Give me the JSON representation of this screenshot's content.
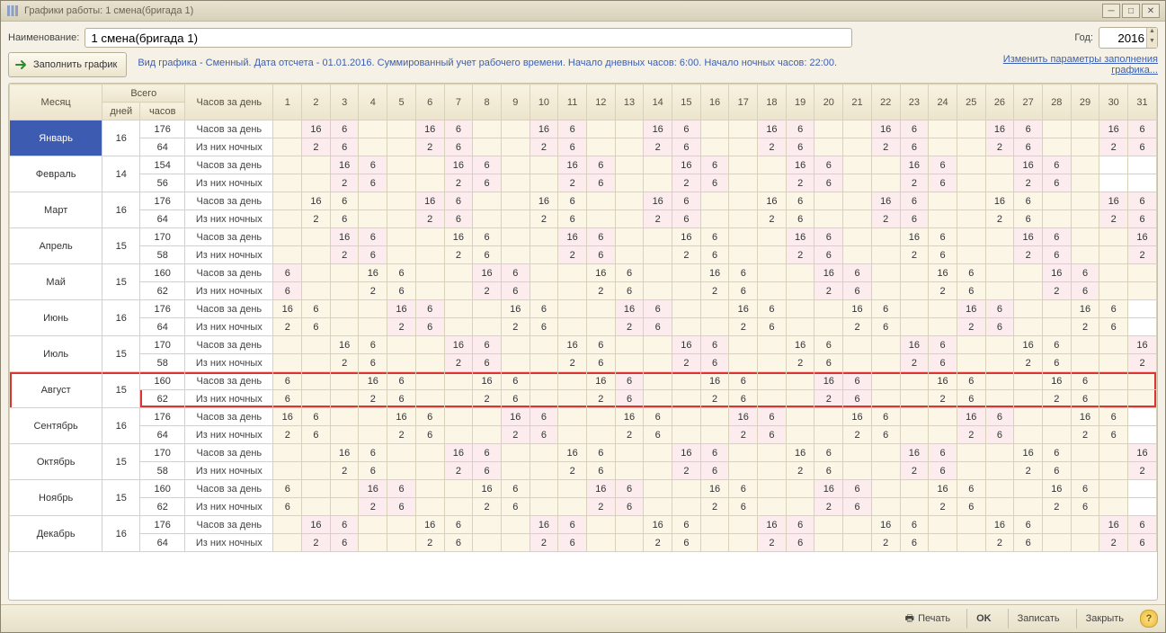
{
  "window": {
    "title": "Графики работы: 1 смена(бригада 1)"
  },
  "toolbar": {
    "name_label": "Наименование:",
    "name_value": "1 смена(бригада 1)",
    "year_label": "Год:",
    "year_value": "2016",
    "fill_label": "Заполнить график",
    "info_text": "Вид графика - Сменный. Дата отсчета - 01.01.2016. Суммированный учет рабочего времени. Начало дневных часов: 6:00. Начало ночных часов: 22:00.",
    "change_link": "Изменить параметры заполнения графика..."
  },
  "footer": {
    "print": "Печать",
    "ok": "OK",
    "save": "Записать",
    "close": "Закрыть"
  },
  "headers": {
    "month": "Месяц",
    "total": "Всего",
    "days": "дней",
    "hours": "часов",
    "row_label": "Часов за день"
  },
  "row_labels": {
    "day": "Часов за день",
    "night": "Из них ночных"
  },
  "day_numbers": [
    1,
    2,
    3,
    4,
    5,
    6,
    7,
    8,
    9,
    10,
    11,
    12,
    13,
    14,
    15,
    16,
    17,
    18,
    19,
    20,
    21,
    22,
    23,
    24,
    25,
    26,
    27,
    28,
    29,
    30,
    31
  ],
  "highlight_month": "Август",
  "selected_month": "Январь",
  "months": [
    {
      "name": "Январь",
      "days": 16,
      "hours": 176,
      "night_hours": 64,
      "pattern": [
        null,
        [
          16,
          2
        ],
        [
          6,
          6
        ],
        null,
        null,
        [
          16,
          2
        ],
        [
          6,
          6
        ],
        null,
        null,
        [
          16,
          2
        ],
        [
          6,
          6
        ],
        null,
        null,
        [
          16,
          2
        ],
        [
          6,
          6
        ],
        null,
        null,
        [
          16,
          2
        ],
        [
          6,
          6
        ],
        null,
        null,
        [
          16,
          2
        ],
        [
          6,
          6
        ],
        null,
        null,
        [
          16,
          2
        ],
        [
          6,
          6
        ],
        null,
        null,
        [
          16,
          2
        ],
        [
          6,
          6
        ]
      ],
      "pink": [
        2,
        3,
        6,
        7,
        10,
        11,
        14,
        15,
        18,
        19,
        22,
        23,
        26,
        27,
        30,
        31
      ],
      "cream": [
        1,
        4,
        5,
        8,
        9,
        12,
        13,
        16,
        17,
        20,
        21,
        24,
        25,
        28,
        29
      ]
    },
    {
      "name": "Февраль",
      "days": 14,
      "hours": 154,
      "night_hours": 56,
      "pattern": [
        null,
        null,
        [
          16,
          2
        ],
        [
          6,
          6
        ],
        null,
        null,
        [
          16,
          2
        ],
        [
          6,
          6
        ],
        null,
        null,
        [
          16,
          2
        ],
        [
          6,
          6
        ],
        null,
        null,
        [
          16,
          2
        ],
        [
          6,
          6
        ],
        null,
        null,
        [
          16,
          2
        ],
        [
          6,
          6
        ],
        null,
        null,
        [
          16,
          2
        ],
        [
          6,
          6
        ],
        null,
        null,
        [
          16,
          2
        ],
        [
          6,
          6
        ],
        null,
        null,
        null
      ],
      "pink": [
        3,
        4,
        7,
        8,
        11,
        12,
        15,
        16,
        19,
        20,
        23,
        24,
        27,
        28
      ],
      "cream": [
        1,
        2,
        5,
        6,
        9,
        10,
        13,
        14,
        17,
        18,
        21,
        22,
        25,
        26,
        29
      ]
    },
    {
      "name": "Март",
      "days": 16,
      "hours": 176,
      "night_hours": 64,
      "pattern": [
        null,
        [
          16,
          2
        ],
        [
          6,
          6
        ],
        null,
        null,
        [
          16,
          2
        ],
        [
          6,
          6
        ],
        null,
        null,
        [
          16,
          2
        ],
        [
          6,
          6
        ],
        null,
        null,
        [
          16,
          2
        ],
        [
          6,
          6
        ],
        null,
        null,
        [
          16,
          2
        ],
        [
          6,
          6
        ],
        null,
        null,
        [
          16,
          2
        ],
        [
          6,
          6
        ],
        null,
        null,
        [
          16,
          2
        ],
        [
          6,
          6
        ],
        null,
        null,
        [
          16,
          2
        ],
        [
          6,
          6
        ]
      ],
      "pink": [
        6,
        7,
        14,
        15,
        22,
        23,
        30,
        31
      ],
      "cream": [
        1,
        2,
        3,
        4,
        5,
        8,
        9,
        10,
        11,
        12,
        13,
        16,
        17,
        18,
        19,
        20,
        21,
        24,
        25,
        26,
        27,
        28,
        29
      ]
    },
    {
      "name": "Апрель",
      "days": 15,
      "hours": 170,
      "night_hours": 58,
      "pattern": [
        null,
        null,
        [
          16,
          2
        ],
        [
          6,
          6
        ],
        null,
        null,
        [
          16,
          2
        ],
        [
          6,
          6
        ],
        null,
        null,
        [
          16,
          2
        ],
        [
          6,
          6
        ],
        null,
        null,
        [
          16,
          2
        ],
        [
          6,
          6
        ],
        null,
        null,
        [
          16,
          2
        ],
        [
          6,
          6
        ],
        null,
        null,
        [
          16,
          2
        ],
        [
          6,
          6
        ],
        null,
        null,
        [
          16,
          2
        ],
        [
          6,
          6
        ],
        null,
        null,
        [
          16,
          2
        ]
      ],
      "pink": [
        3,
        4,
        11,
        12,
        19,
        20,
        27,
        28,
        31
      ],
      "cream": [
        1,
        2,
        5,
        6,
        7,
        8,
        9,
        10,
        13,
        14,
        15,
        16,
        17,
        18,
        21,
        22,
        23,
        24,
        25,
        26,
        29,
        30
      ]
    },
    {
      "name": "Май",
      "days": 15,
      "hours": 160,
      "night_hours": 62,
      "pattern": [
        [
          6,
          6
        ],
        null,
        null,
        [
          16,
          2
        ],
        [
          6,
          6
        ],
        null,
        null,
        [
          16,
          2
        ],
        [
          6,
          6
        ],
        null,
        null,
        [
          16,
          2
        ],
        [
          6,
          6
        ],
        null,
        null,
        [
          16,
          2
        ],
        [
          6,
          6
        ],
        null,
        null,
        [
          16,
          2
        ],
        [
          6,
          6
        ],
        null,
        null,
        [
          16,
          2
        ],
        [
          6,
          6
        ],
        null,
        null,
        [
          16,
          2
        ],
        [
          6,
          6
        ],
        null,
        null
      ],
      "pink": [
        1,
        8,
        9,
        20,
        21,
        28,
        29
      ],
      "cream": [
        2,
        3,
        4,
        5,
        6,
        7,
        10,
        11,
        12,
        13,
        14,
        15,
        16,
        17,
        18,
        19,
        22,
        23,
        24,
        25,
        26,
        27,
        30,
        31
      ]
    },
    {
      "name": "Июнь",
      "days": 16,
      "hours": 176,
      "night_hours": 64,
      "pattern": [
        [
          16,
          2
        ],
        [
          6,
          6
        ],
        null,
        null,
        [
          16,
          2
        ],
        [
          6,
          6
        ],
        null,
        null,
        [
          16,
          2
        ],
        [
          6,
          6
        ],
        null,
        null,
        [
          16,
          2
        ],
        [
          6,
          6
        ],
        null,
        null,
        [
          16,
          2
        ],
        [
          6,
          6
        ],
        null,
        null,
        [
          16,
          2
        ],
        [
          6,
          6
        ],
        null,
        null,
        [
          16,
          2
        ],
        [
          6,
          6
        ],
        null,
        null,
        [
          16,
          2
        ],
        [
          6,
          6
        ],
        null
      ],
      "pink": [
        5,
        6,
        13,
        14,
        25,
        26
      ],
      "cream": [
        1,
        2,
        3,
        4,
        7,
        8,
        9,
        10,
        11,
        12,
        15,
        16,
        17,
        18,
        19,
        20,
        21,
        22,
        23,
        24,
        27,
        28,
        29,
        30
      ]
    },
    {
      "name": "Июль",
      "days": 15,
      "hours": 170,
      "night_hours": 58,
      "pattern": [
        null,
        null,
        [
          16,
          2
        ],
        [
          6,
          6
        ],
        null,
        null,
        [
          16,
          2
        ],
        [
          6,
          6
        ],
        null,
        null,
        [
          16,
          2
        ],
        [
          6,
          6
        ],
        null,
        null,
        [
          16,
          2
        ],
        [
          6,
          6
        ],
        null,
        null,
        [
          16,
          2
        ],
        [
          6,
          6
        ],
        null,
        null,
        [
          16,
          2
        ],
        [
          6,
          6
        ],
        null,
        null,
        [
          16,
          2
        ],
        [
          6,
          6
        ],
        null,
        null,
        [
          16,
          2
        ]
      ],
      "pink": [
        7,
        8,
        15,
        16,
        23,
        24,
        31
      ],
      "cream": [
        1,
        2,
        3,
        4,
        5,
        6,
        9,
        10,
        11,
        12,
        13,
        14,
        17,
        18,
        19,
        20,
        21,
        22,
        25,
        26,
        27,
        28,
        29,
        30
      ]
    },
    {
      "name": "Август",
      "days": 15,
      "hours": 160,
      "night_hours": 62,
      "pattern": [
        [
          6,
          6
        ],
        null,
        null,
        [
          16,
          2
        ],
        [
          6,
          6
        ],
        null,
        null,
        [
          16,
          2
        ],
        [
          6,
          6
        ],
        null,
        null,
        [
          16,
          2
        ],
        [
          6,
          6
        ],
        null,
        null,
        [
          16,
          2
        ],
        [
          6,
          6
        ],
        null,
        null,
        [
          16,
          2
        ],
        [
          6,
          6
        ],
        null,
        null,
        [
          16,
          2
        ],
        [
          6,
          6
        ],
        null,
        null,
        [
          16,
          2
        ],
        [
          6,
          6
        ],
        null,
        null
      ],
      "pink": [
        13,
        20,
        21
      ],
      "cream": [
        1,
        2,
        3,
        4,
        5,
        6,
        7,
        8,
        9,
        10,
        11,
        12,
        14,
        15,
        16,
        17,
        18,
        19,
        22,
        23,
        24,
        25,
        26,
        27,
        28,
        29,
        30,
        31
      ]
    },
    {
      "name": "Сентябрь",
      "days": 16,
      "hours": 176,
      "night_hours": 64,
      "pattern": [
        [
          16,
          2
        ],
        [
          6,
          6
        ],
        null,
        null,
        [
          16,
          2
        ],
        [
          6,
          6
        ],
        null,
        null,
        [
          16,
          2
        ],
        [
          6,
          6
        ],
        null,
        null,
        [
          16,
          2
        ],
        [
          6,
          6
        ],
        null,
        null,
        [
          16,
          2
        ],
        [
          6,
          6
        ],
        null,
        null,
        [
          16,
          2
        ],
        [
          6,
          6
        ],
        null,
        null,
        [
          16,
          2
        ],
        [
          6,
          6
        ],
        null,
        null,
        [
          16,
          2
        ],
        [
          6,
          6
        ],
        null
      ],
      "pink": [
        9,
        10,
        17,
        18,
        25,
        26
      ],
      "cream": [
        1,
        2,
        3,
        4,
        5,
        6,
        7,
        8,
        11,
        12,
        13,
        14,
        15,
        16,
        19,
        20,
        21,
        22,
        23,
        24,
        27,
        28,
        29,
        30
      ]
    },
    {
      "name": "Октябрь",
      "days": 15,
      "hours": 170,
      "night_hours": 58,
      "pattern": [
        null,
        null,
        [
          16,
          2
        ],
        [
          6,
          6
        ],
        null,
        null,
        [
          16,
          2
        ],
        [
          6,
          6
        ],
        null,
        null,
        [
          16,
          2
        ],
        [
          6,
          6
        ],
        null,
        null,
        [
          16,
          2
        ],
        [
          6,
          6
        ],
        null,
        null,
        [
          16,
          2
        ],
        [
          6,
          6
        ],
        null,
        null,
        [
          16,
          2
        ],
        [
          6,
          6
        ],
        null,
        null,
        [
          16,
          2
        ],
        [
          6,
          6
        ],
        null,
        null,
        [
          16,
          2
        ]
      ],
      "pink": [
        7,
        8,
        15,
        16,
        23,
        24,
        31
      ],
      "cream": [
        1,
        2,
        3,
        4,
        5,
        6,
        9,
        10,
        11,
        12,
        13,
        14,
        17,
        18,
        19,
        20,
        21,
        22,
        25,
        26,
        27,
        28,
        29,
        30
      ]
    },
    {
      "name": "Ноябрь",
      "days": 15,
      "hours": 160,
      "night_hours": 62,
      "pattern": [
        [
          6,
          6
        ],
        null,
        null,
        [
          16,
          2
        ],
        [
          6,
          6
        ],
        null,
        null,
        [
          16,
          2
        ],
        [
          6,
          6
        ],
        null,
        null,
        [
          16,
          2
        ],
        [
          6,
          6
        ],
        null,
        null,
        [
          16,
          2
        ],
        [
          6,
          6
        ],
        null,
        null,
        [
          16,
          2
        ],
        [
          6,
          6
        ],
        null,
        null,
        [
          16,
          2
        ],
        [
          6,
          6
        ],
        null,
        null,
        [
          16,
          2
        ],
        [
          6,
          6
        ],
        null,
        null
      ],
      "pink": [
        4,
        5,
        12,
        13,
        20,
        21
      ],
      "cream": [
        1,
        2,
        3,
        6,
        7,
        8,
        9,
        10,
        11,
        14,
        15,
        16,
        17,
        18,
        19,
        22,
        23,
        24,
        25,
        26,
        27,
        28,
        29,
        30
      ]
    },
    {
      "name": "Декабрь",
      "days": 16,
      "hours": 176,
      "night_hours": 64,
      "pattern": [
        null,
        [
          16,
          2
        ],
        [
          6,
          6
        ],
        null,
        null,
        [
          16,
          2
        ],
        [
          6,
          6
        ],
        null,
        null,
        [
          16,
          2
        ],
        [
          6,
          6
        ],
        null,
        null,
        [
          16,
          2
        ],
        [
          6,
          6
        ],
        null,
        null,
        [
          16,
          2
        ],
        [
          6,
          6
        ],
        null,
        null,
        [
          16,
          2
        ],
        [
          6,
          6
        ],
        null,
        null,
        [
          16,
          2
        ],
        [
          6,
          6
        ],
        null,
        null,
        [
          16,
          2
        ],
        [
          6,
          6
        ]
      ],
      "pink": [
        2,
        3,
        10,
        11,
        18,
        19,
        30,
        31
      ],
      "cream": [
        1,
        4,
        5,
        6,
        7,
        8,
        9,
        12,
        13,
        14,
        15,
        16,
        17,
        20,
        21,
        22,
        23,
        24,
        25,
        26,
        27,
        28,
        29
      ]
    }
  ]
}
